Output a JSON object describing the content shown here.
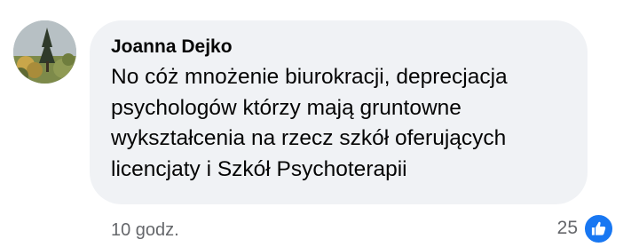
{
  "comment": {
    "author": "Joanna Dejko",
    "text": "No cóż mnożenie biurokracji, deprecjacja psychologów którzy mają gruntowne wykształcenia na rzecz szkół oferujących licencjaty i Szkół Psychoterapii",
    "timestamp": "10 godz.",
    "reaction_count": "25",
    "reaction_icon": "like-icon",
    "colors": {
      "bubble": "#f0f2f5",
      "like": "#1877f2",
      "meta_text": "#65676b"
    }
  }
}
